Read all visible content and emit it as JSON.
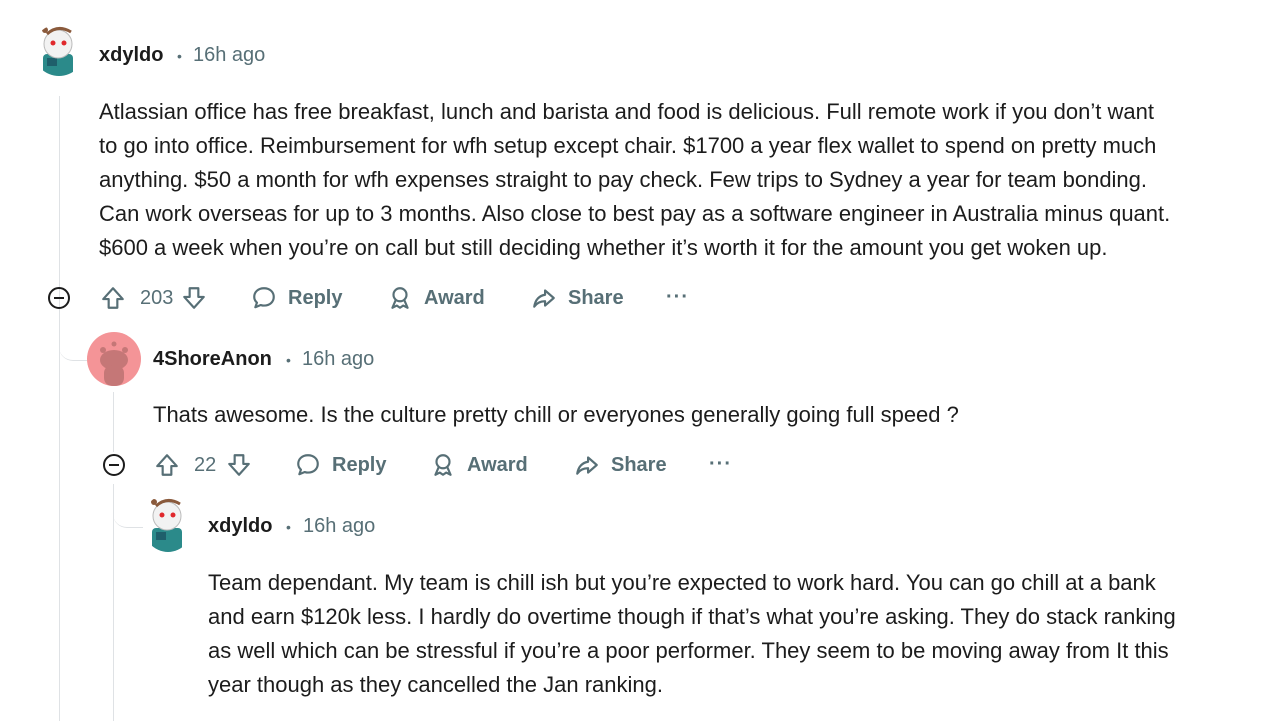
{
  "comments": [
    {
      "username": "xdyldo",
      "time": "16h ago",
      "body": "Atlassian office has free breakfast, lunch and barista and food is delicious. Full remote work if you don’t want\nto go into office. Reimbursement for wfh setup except chair. $1700 a year flex wallet to spend on pretty much\nanything. $50 a month for wfh expenses straight to pay check. Few trips to Sydney a year for team bonding.\nCan work overseas for up to 3 months. Also close to best pay as a software engineer in Australia minus quant.\n$600 a week when you’re on call but still deciding whether it’s worth it for the amount you get woken up.",
      "votes": "203",
      "reply_label": "Reply",
      "award_label": "Award",
      "share_label": "Share",
      "more_label": "···"
    },
    {
      "username": "4ShoreAnon",
      "time": "16h ago",
      "body": "Thats awesome. Is the culture pretty chill or everyones generally going full speed ?",
      "votes": "22",
      "reply_label": "Reply",
      "award_label": "Award",
      "share_label": "Share",
      "more_label": "···"
    },
    {
      "username": "xdyldo",
      "time": "16h ago",
      "body": "Team dependant. My team is chill ish but you’re expected to work hard. You can go chill at a bank\nand earn $120k less. I hardly do overtime though if that’s what you’re asking. They do stack ranking\nas well which can be stressful if you’re a poor performer. They seem to be moving away from It this\nyear though as they cancelled the Jan ranking."
    }
  ],
  "separator": "•",
  "colors": {
    "text": "#1c1c1c",
    "meta": "#576f76",
    "thread": "#dfe2e5",
    "avatar_pink": "#f49497"
  }
}
